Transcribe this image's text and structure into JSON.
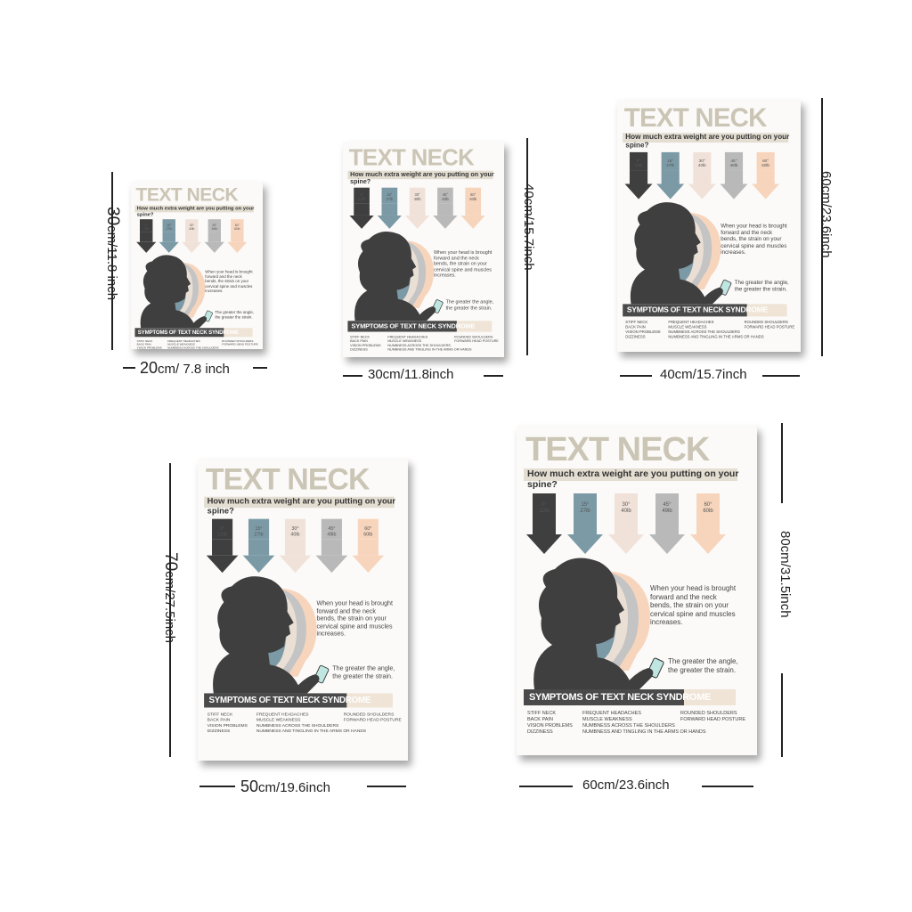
{
  "poster": {
    "title": "TEXT NECK",
    "subtitle": "How much extra weight are you putting on your spine?",
    "angles": [
      {
        "angle": "0°",
        "weight": "12lb",
        "color": "#3f3f3f"
      },
      {
        "angle": "15°",
        "weight": "27lb",
        "color": "#7b9aa6"
      },
      {
        "angle": "30°",
        "weight": "40lb",
        "color": "#f0e2d8"
      },
      {
        "angle": "45°",
        "weight": "49lb",
        "color": "#b9b9b9"
      },
      {
        "angle": "60°",
        "weight": "60lb",
        "color": "#f7d5bd"
      }
    ],
    "text1": "When your head is brought forward and the neck bends, the strain on your cervical spine and muscles increases.",
    "text2": "The greater the angle, the greater the strain.",
    "symptoms_title": "SYMPTOMS OF TEXT NECK SYNDROME",
    "symptoms": [
      [
        "STIFF NECK",
        "BACK PAIN",
        "VISION PROBLEMS",
        "DIZZINESS"
      ],
      [
        "FREQUENT HEADACHES",
        "MUSCLE WEAKNESS",
        "NUMBNESS ACROSS THE SHOULDERS",
        "NUMBNESS AND TINGLING IN THE ARMS OR HANDS"
      ],
      [
        "ROUNDED SHOULDERS",
        "FORWARD HEAD POSTURE"
      ]
    ]
  },
  "sizes": {
    "s1_w_big": "20",
    "s1_w": "cm/ 7.8 inch",
    "s1_h_big": "30",
    "s1_h": "cm/11.8 inch",
    "s2_w": "30cm/11.8inch",
    "s2_h": "40cm/15.7inch",
    "s3_w": "40cm/15.7inch",
    "s3_h": "60cm/23.6inch",
    "s4_w_big": "50",
    "s4_w": "cm/19.6inch",
    "s4_h_big": "70",
    "s4_h": "cm/27.5inch",
    "s5_w": "60cm/23.6inch",
    "s5_h": "80cm/31.5inch"
  },
  "colors": {
    "silhouette": "#3f3f3f",
    "title": "#cbc5b5",
    "symptom_bar": "#4a4a4a"
  }
}
